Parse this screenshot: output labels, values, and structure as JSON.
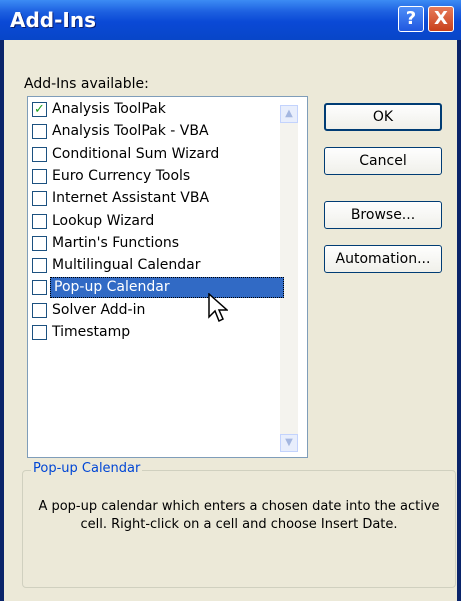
{
  "window": {
    "title": "Add-Ins",
    "help_glyph": "?",
    "close_glyph": "X"
  },
  "available_label": "Add-Ins available:",
  "items": [
    {
      "label": "Analysis ToolPak",
      "checked": true
    },
    {
      "label": "Analysis ToolPak - VBA",
      "checked": false
    },
    {
      "label": "Conditional Sum Wizard",
      "checked": false
    },
    {
      "label": "Euro Currency Tools",
      "checked": false
    },
    {
      "label": "Internet Assistant VBA",
      "checked": false
    },
    {
      "label": "Lookup Wizard",
      "checked": false
    },
    {
      "label": "Martin's Functions",
      "checked": false
    },
    {
      "label": "Multilingual Calendar",
      "checked": false
    },
    {
      "label": "Pop-up Calendar",
      "checked": false,
      "selected": true
    },
    {
      "label": "Solver Add-in",
      "checked": false
    },
    {
      "label": "Timestamp",
      "checked": false
    }
  ],
  "buttons": {
    "ok": "OK",
    "cancel": "Cancel",
    "browse": "Browse...",
    "automation": "Automation..."
  },
  "description": {
    "title": "Pop-up Calendar",
    "text": "A pop-up calendar which enters a chosen date into the active cell. Right-click on a cell and choose Insert Date."
  },
  "colors": {
    "titlebar": "#0a49d6",
    "selection": "#316ac5",
    "face": "#ece9d8",
    "group_title": "#0046d5"
  },
  "icons": {
    "help": "help-icon",
    "close": "close-icon",
    "check": "checkmark-icon",
    "cursor": "mouse-pointer-icon"
  }
}
